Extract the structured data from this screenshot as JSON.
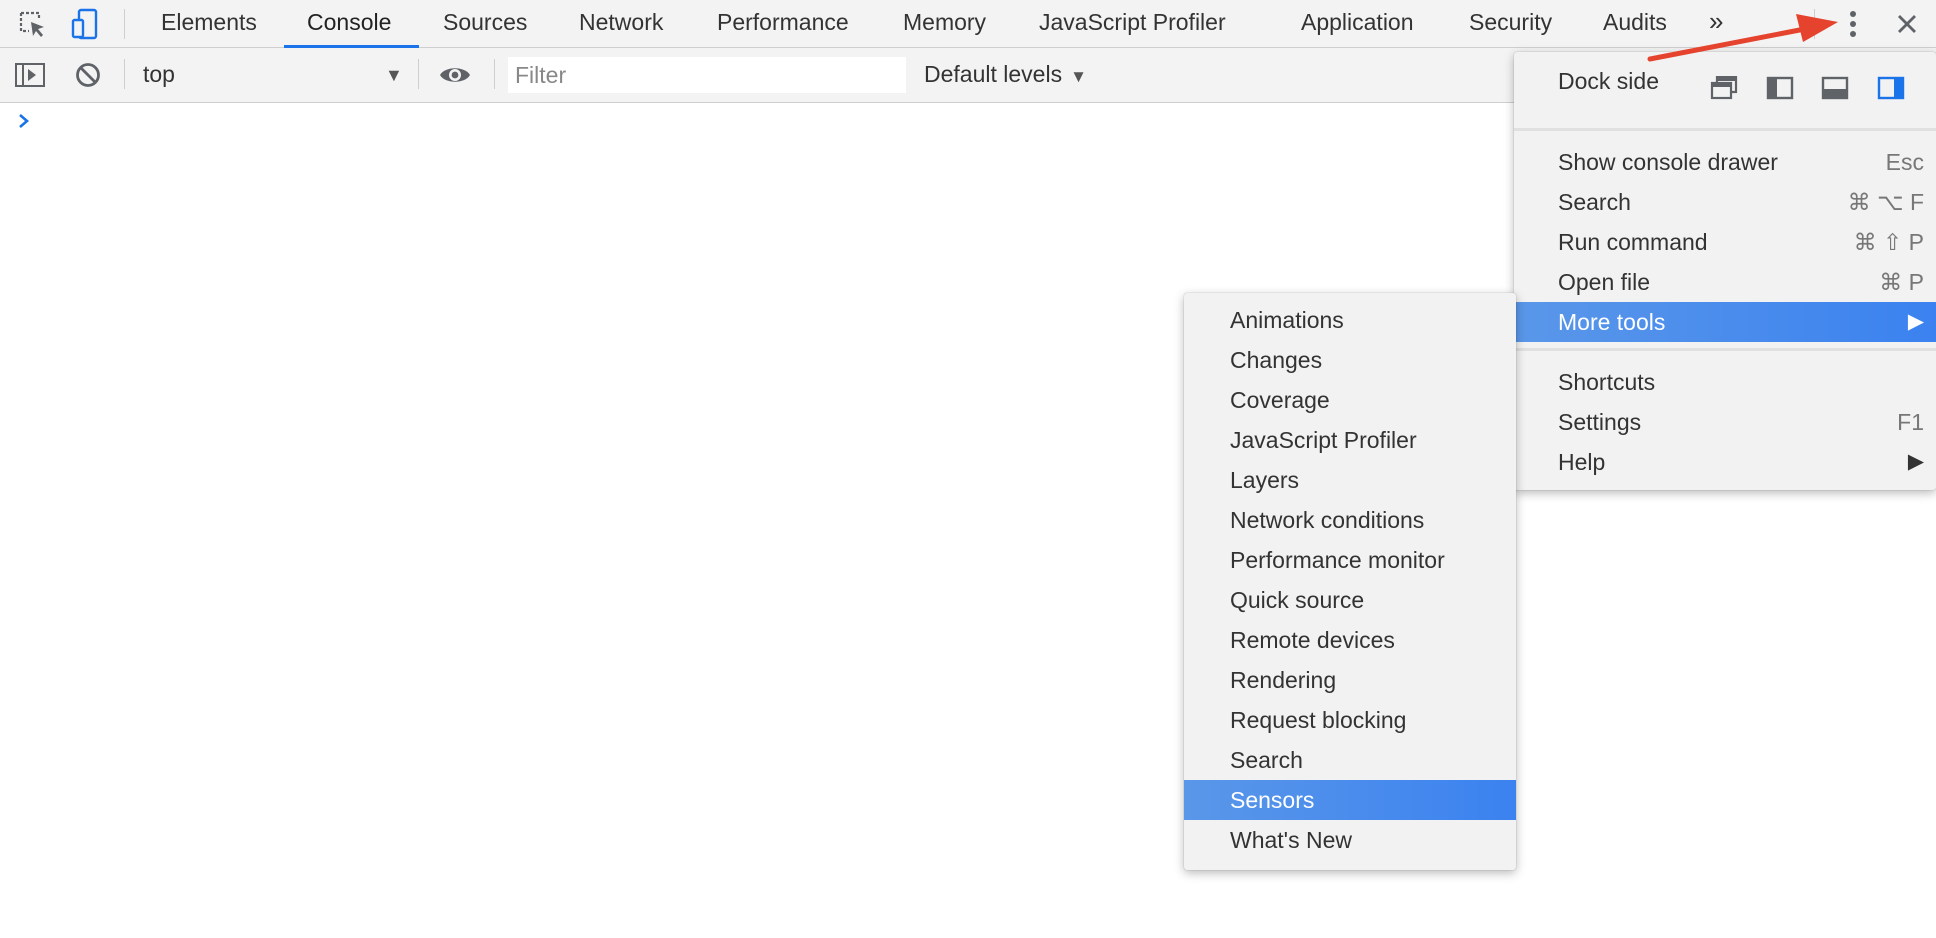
{
  "tabbar": {
    "tabs": [
      {
        "label": "Elements"
      },
      {
        "label": "Console"
      },
      {
        "label": "Sources"
      },
      {
        "label": "Network"
      },
      {
        "label": "Performance"
      },
      {
        "label": "Memory"
      },
      {
        "label": "JavaScript Profiler"
      },
      {
        "label": "Application"
      },
      {
        "label": "Security"
      },
      {
        "label": "Audits"
      }
    ],
    "active_tab": "Console",
    "overflow_label": "»"
  },
  "console_toolbar": {
    "context_value": "top",
    "filter_placeholder": "Filter",
    "levels_label": "Default levels"
  },
  "main_menu": {
    "dock_side_label": "Dock side",
    "items": [
      {
        "label": "Show console drawer",
        "shortcut": "Esc"
      },
      {
        "label": "Search",
        "shortcut": "⌘ ⌥ F"
      },
      {
        "label": "Run command",
        "shortcut": "⌘ ⇧ P"
      },
      {
        "label": "Open file",
        "shortcut": "⌘ P"
      },
      {
        "label": "More tools",
        "shortcut": ""
      },
      {
        "label": "Shortcuts",
        "shortcut": ""
      },
      {
        "label": "Settings",
        "shortcut": "F1"
      },
      {
        "label": "Help",
        "shortcut": ""
      }
    ],
    "highlighted": "More tools"
  },
  "more_tools_menu": {
    "items": [
      {
        "label": "Animations"
      },
      {
        "label": "Changes"
      },
      {
        "label": "Coverage"
      },
      {
        "label": "JavaScript Profiler"
      },
      {
        "label": "Layers"
      },
      {
        "label": "Network conditions"
      },
      {
        "label": "Performance monitor"
      },
      {
        "label": "Quick source"
      },
      {
        "label": "Remote devices"
      },
      {
        "label": "Rendering"
      },
      {
        "label": "Request blocking"
      },
      {
        "label": "Search"
      },
      {
        "label": "Sensors"
      },
      {
        "label": "What's New"
      }
    ],
    "highlighted": "Sensors"
  },
  "colors": {
    "accent": "#1a73e8",
    "highlight": "#3b82f0",
    "annotation_arrow": "#e5432d"
  },
  "icons": {
    "inspect": "cursor-select-icon",
    "device": "device-toggle-icon",
    "sidebar": "sidebar-toggle-icon",
    "clear": "clear-console-icon",
    "eye": "live-expression-icon",
    "kebab": "more-options-icon",
    "close": "close-icon"
  }
}
